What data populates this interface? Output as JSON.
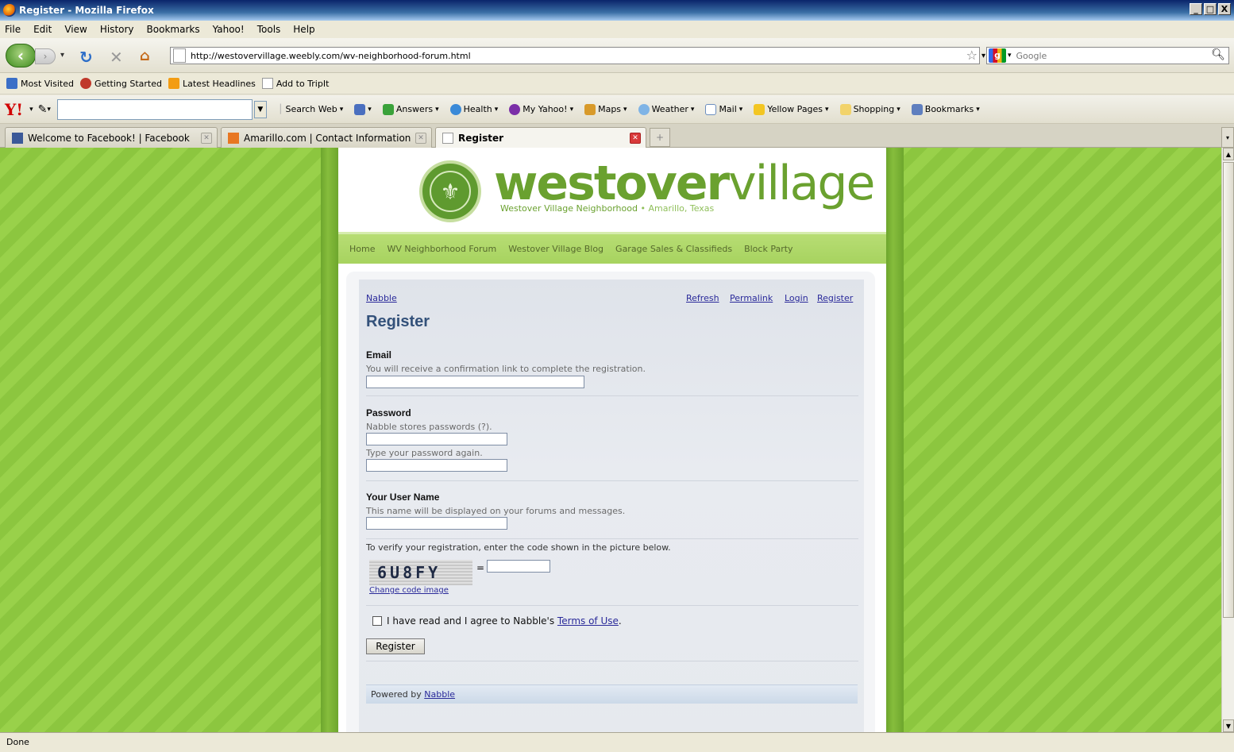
{
  "window": {
    "title": "Register - Mozilla Firefox",
    "buttons": [
      "_",
      "□",
      "X"
    ]
  },
  "menu": [
    "File",
    "Edit",
    "View",
    "History",
    "Bookmarks",
    "Yahoo!",
    "Tools",
    "Help"
  ],
  "nav": {
    "url": "http://westovervillage.weebly.com/wv-neighborhood-forum.html",
    "search_placeholder": "Google"
  },
  "bookmarks": [
    "Most Visited",
    "Getting Started",
    "Latest Headlines",
    "Add to TripIt"
  ],
  "yahoo_toolbar": {
    "logo": "Y!",
    "search_web": "Search Web",
    "items": [
      "Answers",
      "Health",
      "My Yahoo!",
      "Maps",
      "Weather",
      "Mail",
      "Yellow Pages",
      "Shopping",
      "Bookmarks"
    ]
  },
  "tabs": [
    {
      "label": "Welcome to Facebook! | Facebook"
    },
    {
      "label": "Amarillo.com | Contact Information"
    },
    {
      "label": "Register"
    }
  ],
  "site": {
    "brand_bold": "westover",
    "brand_light": "village",
    "tagline_1": "Westover Village Neighborhood",
    "tagline_sep": " • ",
    "tagline_2": "Amarillo, Texas",
    "nav": [
      "Home",
      "WV Neighborhood Forum",
      "Westover Village Blog",
      "Garage Sales & Classifieds",
      "Block Party"
    ]
  },
  "nabble": {
    "home_link": "Nabble",
    "top_links": [
      "Refresh",
      "Permalink",
      "Login",
      "Register"
    ],
    "title": "Register",
    "email_label": "Email",
    "email_hint": "You will receive a confirmation link to complete the registration.",
    "password_label": "Password",
    "password_hint": "Nabble stores passwords (?).",
    "password_again_hint": "Type your password again.",
    "username_label": "Your User Name",
    "username_hint": "This name will be displayed on your forums and messages.",
    "verify_text": "To verify your registration, enter the code shown in the picture below.",
    "captcha_text": "6U8FY",
    "captcha_eq": "=",
    "change_code": "Change code image",
    "terms_prefix": "I have read and I agree to Nabble's ",
    "terms_link": "Terms of Use",
    "terms_suffix": ".",
    "register_button": "Register",
    "powered_prefix": "Powered by ",
    "powered_link": "Nabble"
  },
  "status": "Done"
}
